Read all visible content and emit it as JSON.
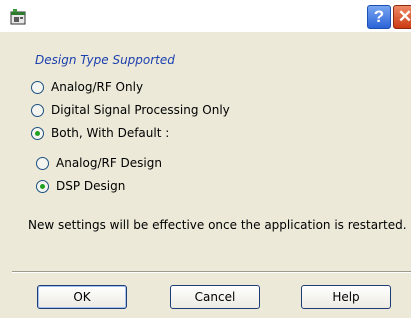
{
  "titlebar": {
    "app_icon": "app-window-icon",
    "help_glyph": "?",
    "close_glyph": "✕"
  },
  "group": {
    "label": "Design Type Supported"
  },
  "options": [
    {
      "label": "Analog/RF Only",
      "checked": false
    },
    {
      "label": "Digital Signal Processing Only",
      "checked": false
    },
    {
      "label": "Both, With Default :",
      "checked": true
    }
  ],
  "default_options": [
    {
      "label": "Analog/RF Design",
      "checked": false
    },
    {
      "label": "DSP Design",
      "checked": true
    }
  ],
  "note": "New settings will be effective once the application is restarted.",
  "buttons": {
    "ok": "OK",
    "cancel": "Cancel",
    "help": "Help"
  }
}
